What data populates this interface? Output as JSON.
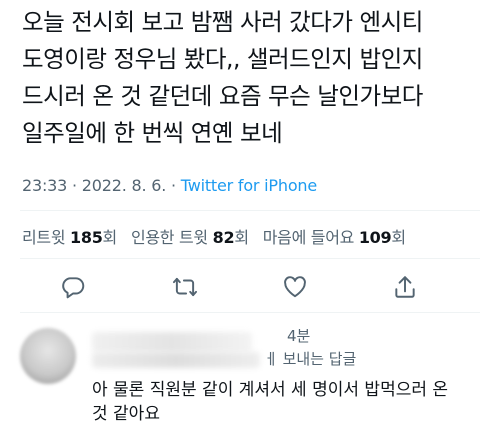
{
  "tweet": {
    "text_lines": [
      "오늘 전시회 보고 밤쨈 사러 갔다가 엔시티",
      "도영이랑 정우님 봤다,, 샐러드인지 밥인지",
      "드시러 온 것 같던데 요즘 무슨 날인가보다",
      "일주일에 한 번씩 연옌 보네"
    ],
    "time": "23:33",
    "separator": " · ",
    "date": "2022. 8. 6.",
    "source": "Twitter for iPhone"
  },
  "stats": {
    "retweets_label": "리트윗 ",
    "retweets_count": "185",
    "retweets_unit": "회",
    "quotes_label": "인용한 트윗 ",
    "quotes_count": "82",
    "quotes_unit": "회",
    "likes_label": "마음에 들어요 ",
    "likes_count": "109",
    "likes_unit": "회"
  },
  "actions": [
    {
      "name": "reply-icon"
    },
    {
      "name": "retweet-icon"
    },
    {
      "name": "like-icon"
    },
    {
      "name": "share-icon"
    }
  ],
  "reply": {
    "time": "4분",
    "context": "ㅔ 보내는 답글",
    "text_lines": [
      "아 물론 직원분 같이 계셔서 세 명이서 밥먹으러 온",
      "것 같아요"
    ]
  },
  "colors": {
    "text": "#0f1419",
    "secondary": "#536471",
    "link": "#1d9bf0",
    "divider": "#eff3f4"
  }
}
